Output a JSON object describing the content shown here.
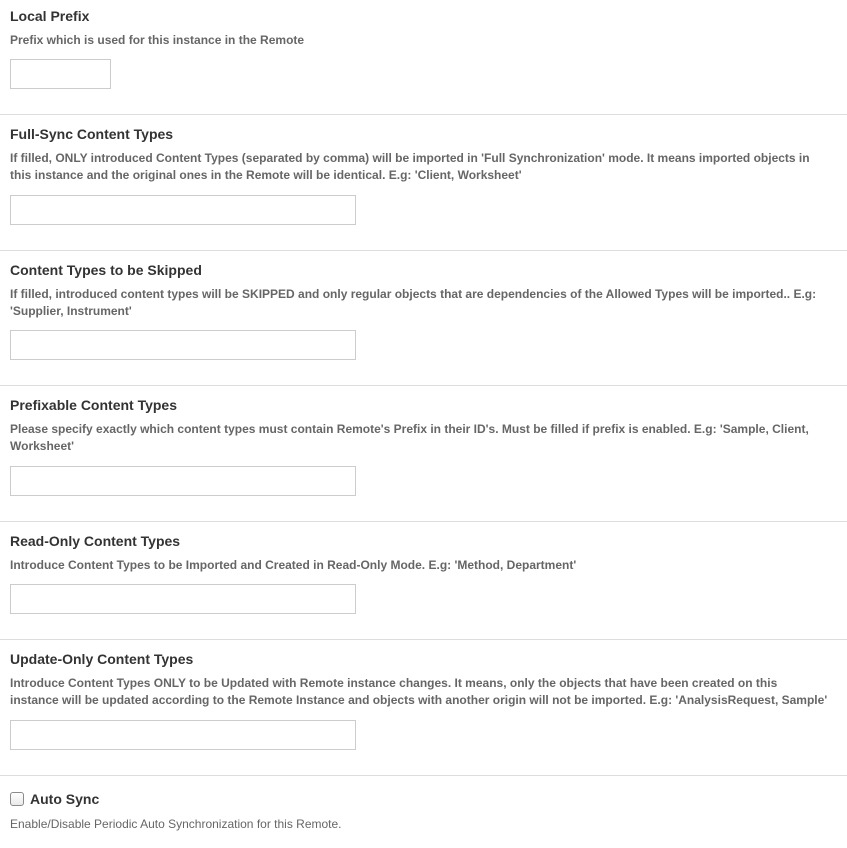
{
  "fields": [
    {
      "title": "Local Prefix",
      "help": "Prefix which is used for this instance in the Remote",
      "value": ""
    },
    {
      "title": "Full-Sync Content Types",
      "help": "If filled, ONLY introduced Content Types (separated by comma) will be imported in 'Full Synchronization' mode. It means imported objects in this instance and the original ones in the Remote will be identical. E.g: 'Client, Worksheet'",
      "value": ""
    },
    {
      "title": "Content Types to be Skipped",
      "help": "If filled, introduced content types will be SKIPPED and only regular objects that are dependencies of the Allowed Types will be imported.. E.g: 'Supplier, Instrument'",
      "value": ""
    },
    {
      "title": "Prefixable Content Types",
      "help": "Please specify exactly which content types must contain Remote's Prefix in their ID's. Must be filled if prefix is enabled. E.g: 'Sample, Client, Worksheet'",
      "value": ""
    },
    {
      "title": "Read-Only Content Types",
      "help": "Introduce Content Types to be Imported and Created in Read-Only Mode. E.g: 'Method, Department'",
      "value": ""
    },
    {
      "title": "Update-Only Content Types",
      "help": "Introduce Content Types ONLY to be Updated with Remote instance changes. It means, only the objects that have been created on this instance will be updated according to the Remote Instance and objects with another origin will not be imported. E.g: 'AnalysisRequest, Sample'",
      "value": ""
    }
  ],
  "auto_sync": {
    "label": "Auto Sync",
    "help": "Enable/Disable Periodic Auto Synchronization for this Remote.",
    "checked": false
  }
}
